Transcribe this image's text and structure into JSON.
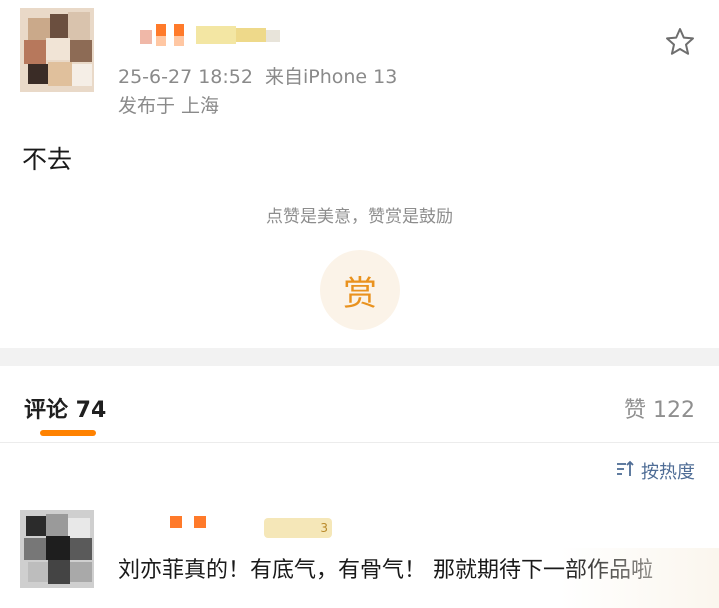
{
  "post": {
    "datetime": "25-6-27 18:52",
    "source": "来自iPhone 13",
    "location": "发布于 上海",
    "content": "不去",
    "reward_tip": "点赞是美意，赞赏是鼓励",
    "reward_label": "赏"
  },
  "tabs": {
    "comments_label": "评论 74",
    "likes_label": "赞 122"
  },
  "sort": {
    "label": "按热度"
  },
  "comment": {
    "badge_text": "3",
    "text": "刘亦菲真的！有底气，有骨气！ 那就期待下一部作品啦"
  },
  "colors": {
    "accent": "#ff8200",
    "reward": "#e9921e",
    "link": "#4f6d96",
    "muted": "#8a8a8a"
  },
  "icons": {
    "favorite": "star-outline-icon",
    "sort": "sort-lines-icon"
  }
}
